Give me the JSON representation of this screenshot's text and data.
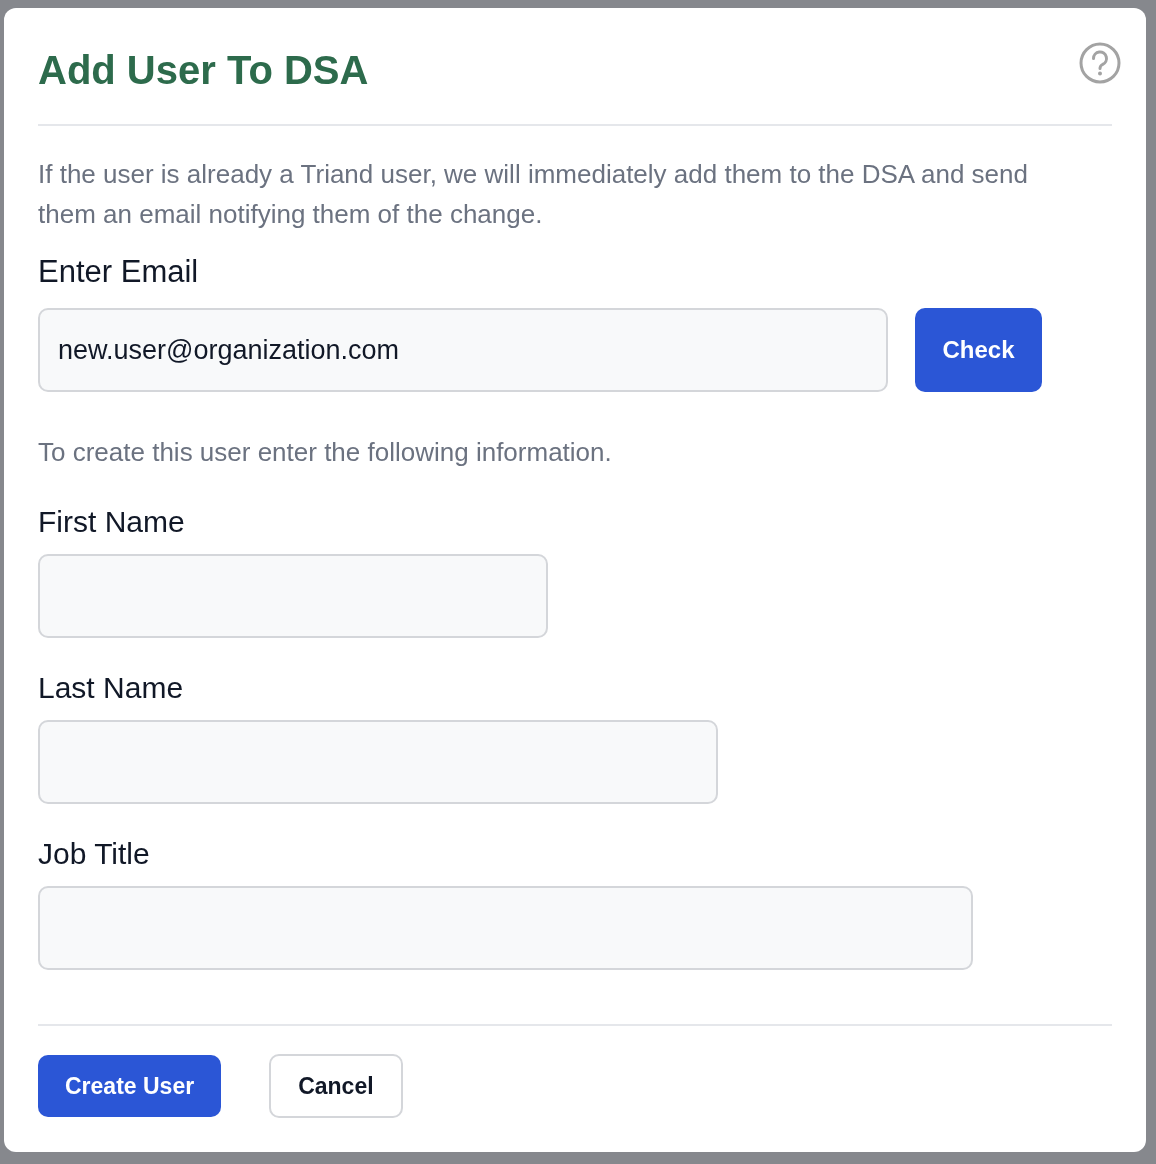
{
  "dialog": {
    "title": "Add User To DSA",
    "intro": "If the user is already a Triand user, we will immediately add them to the DSA and send them an email notifying them of the change.",
    "email": {
      "label": "Enter Email",
      "value": "new.user@organization.com",
      "button": "Check"
    },
    "instructions": "To create this user enter the following information.",
    "fields": [
      {
        "label": "First Name"
      },
      {
        "label": "Last Name"
      },
      {
        "label": "Job Title"
      }
    ],
    "buttons": [
      {
        "label": "Create User",
        "kind": "primary"
      },
      {
        "label": "Cancel",
        "kind": "secondary"
      }
    ]
  }
}
